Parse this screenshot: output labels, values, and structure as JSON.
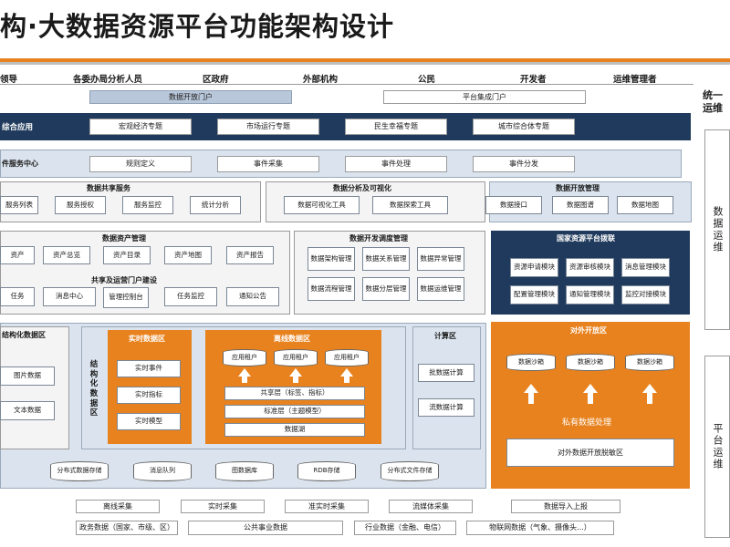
{
  "title": "构·大数据资源平台功能架构设计",
  "users": [
    "领导",
    "各委办局分析人员",
    "区政府",
    "外部机构",
    "公民",
    "开发者",
    "运维管理者"
  ],
  "portals": {
    "open": "数据开放门户",
    "integration": "平台集成门户"
  },
  "apps": {
    "title": "综合应用",
    "items": [
      "宏观经济专题",
      "市场运行专题",
      "民生幸福专题",
      "城市综合体专题"
    ]
  },
  "events": {
    "title": "件服务中心",
    "items": [
      "规则定义",
      "事件采集",
      "事件处理",
      "事件分发"
    ]
  },
  "share": {
    "title": "数据共享服务",
    "items": [
      "服务列表",
      "服务授权",
      "服务监控",
      "统计分析"
    ]
  },
  "viz": {
    "title": "数据分析及可视化",
    "items": [
      "数据可视化工具",
      "数据探索工具"
    ]
  },
  "openmgmt": {
    "title": "数据开放管理",
    "items": [
      "数据接口",
      "数据图谱",
      "数据地图"
    ]
  },
  "assets": {
    "title": "数据资产管理",
    "items": [
      "资产",
      "资产总览",
      "资产目录",
      "资产地图",
      "资产报告"
    ]
  },
  "portalbuild": {
    "title": "共享及运营门户建设",
    "items": [
      "任务",
      "消息中心",
      "管理控制台",
      "任务监控",
      "通知公告"
    ]
  },
  "devops": {
    "title": "数据开发调度管理",
    "items": [
      "数据架构管理",
      "数据关系管理",
      "数据异常管理",
      "数据流程管理",
      "数据分层管理",
      "数据运维管理"
    ]
  },
  "national": {
    "title": "国家资源平台拨联",
    "items": [
      "资源申请模块",
      "资源审核模块",
      "消息管理模块",
      "配置管理模块",
      "通知管理模块",
      "监控对接模块"
    ]
  },
  "unstruct": {
    "title": "结构化数据区",
    "items": [
      "图片数据",
      "文本数据"
    ]
  },
  "structured": {
    "label": "结构化数据区"
  },
  "realtime": {
    "title": "实时数据区",
    "items": [
      "实时事件",
      "实时指标",
      "实时模型"
    ]
  },
  "offline": {
    "title": "离线数据区",
    "apps": [
      "应用租户",
      "应用租户",
      "应用租户"
    ],
    "layers": [
      "共享层（标签、指标）",
      "标准层（主题模型）",
      "数据湖"
    ]
  },
  "compute": {
    "title": "计算区",
    "items": [
      "批数据计算",
      "流数据计算"
    ]
  },
  "external": {
    "title": "对外开放区",
    "sandboxes": [
      "数据沙箱",
      "数据沙箱",
      "数据沙箱"
    ],
    "private": "私有数据处理",
    "desens": "对外数据开放脱敏区"
  },
  "storage": [
    "分布式数据存储",
    "消息队列",
    "图数据库",
    "RDB存储",
    "分布式文件存储"
  ],
  "collect": [
    "离线采集",
    "实时采集",
    "准实时采集",
    "流媒体采集",
    "数据导入上报"
  ],
  "sources": [
    "政务数据（国家、市级、区）",
    "公共事业数据",
    "行业数据（金融、电信）",
    "物联网数据（气象、摄像头...）"
  ],
  "right": {
    "top": "统一运维",
    "mid": "数据运维",
    "bottom": "平台运维"
  }
}
